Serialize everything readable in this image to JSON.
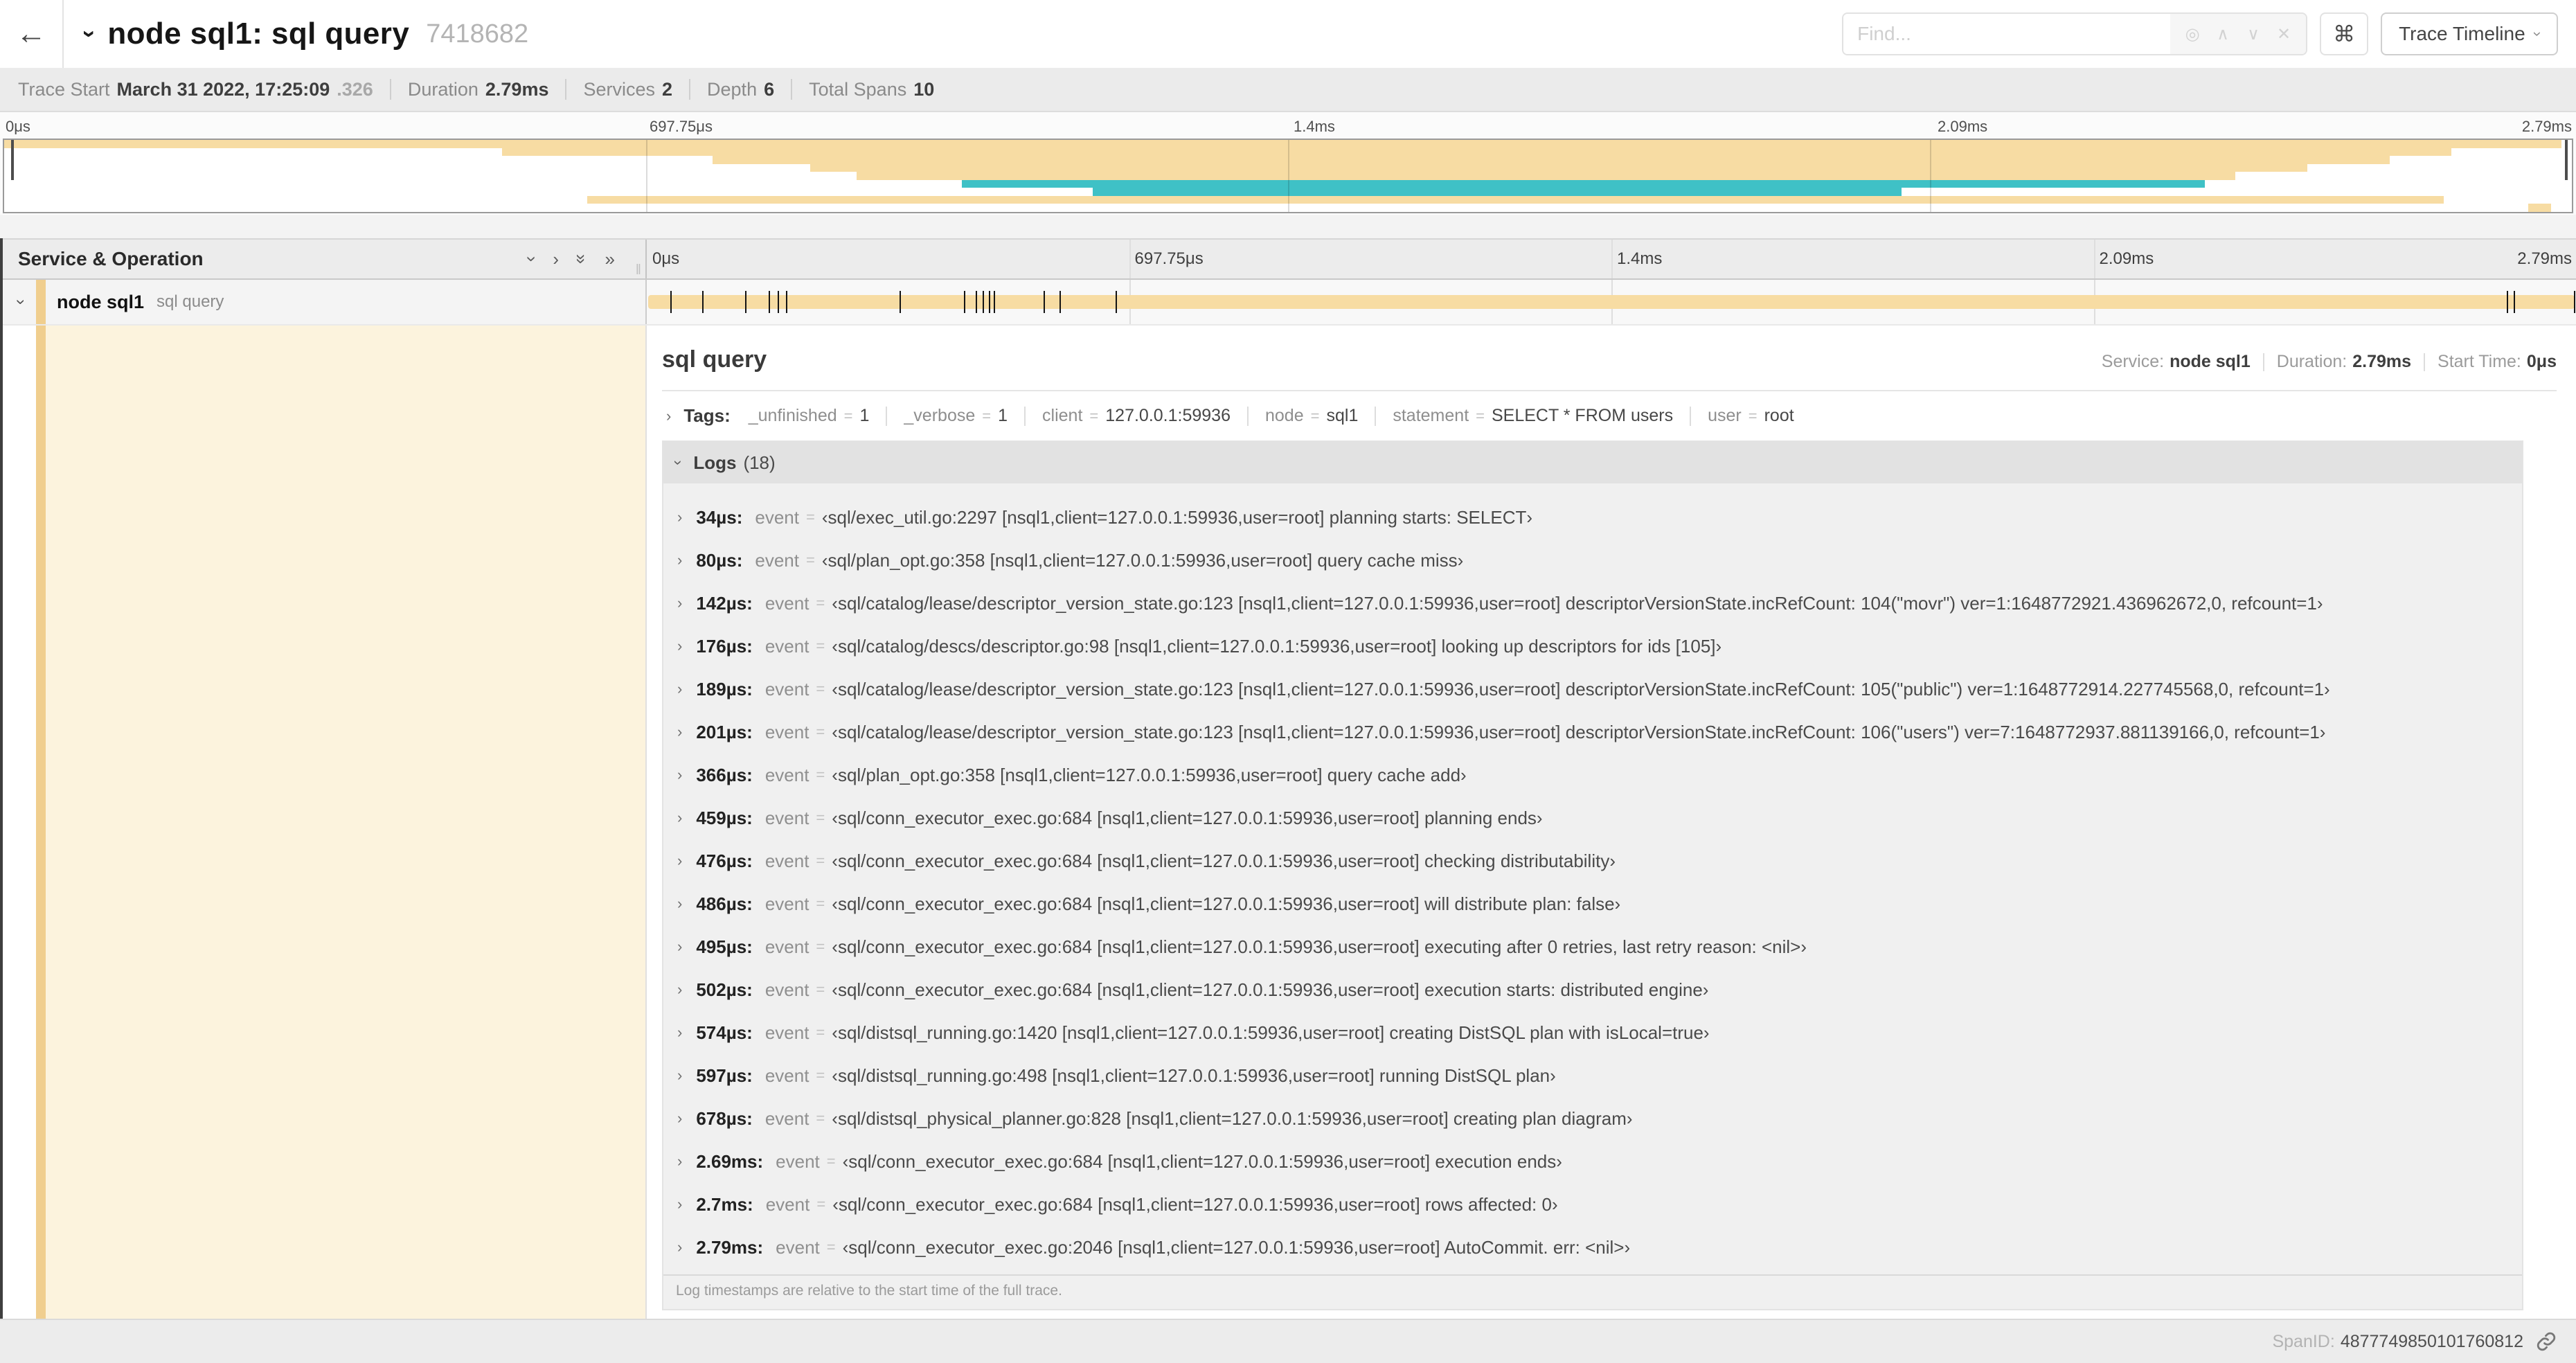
{
  "colors": {
    "tan": "#F7DCA3",
    "teal": "#3FC1C6",
    "stripe": "#F0CE8E"
  },
  "icons": {
    "back": "←",
    "chevron": "›",
    "double_chevron": "»",
    "command": "⌘",
    "locate": "◎",
    "up": "∧",
    "down": "∨",
    "clear": "✕",
    "grip": "‖"
  },
  "header": {
    "title": "node sql1: sql query",
    "trace_id": "7418682",
    "find_placeholder": "Find...",
    "view_select": "Trace Timeline"
  },
  "trace_meta": [
    {
      "label": "Trace Start",
      "value": "March 31 2022, 17:25:09",
      "suffix": ".326"
    },
    {
      "label": "Duration",
      "value": "2.79ms"
    },
    {
      "label": "Services",
      "value": "2"
    },
    {
      "label": "Depth",
      "value": "6"
    },
    {
      "label": "Total Spans",
      "value": "10"
    }
  ],
  "timeline": {
    "ticks": [
      {
        "label": "0μs",
        "pos": 0
      },
      {
        "label": "697.75μs",
        "pos": 25
      },
      {
        "label": "1.4ms",
        "pos": 50
      },
      {
        "label": "2.09ms",
        "pos": 75
      },
      {
        "label": "2.79ms",
        "pos": 100
      }
    ]
  },
  "minimap": {
    "rows": [
      {
        "start": 0,
        "end": 99.6,
        "color": "tan"
      },
      {
        "start": 19.4,
        "end": 95.3,
        "color": "tan"
      },
      {
        "start": 27.6,
        "end": 92.9,
        "color": "tan"
      },
      {
        "start": 31.4,
        "end": 89.7,
        "color": "tan"
      },
      {
        "start": 33.2,
        "end": 86.9,
        "color": "tan"
      },
      {
        "start": 37.3,
        "end": 85.7,
        "color": "teal"
      },
      {
        "start": 42.4,
        "end": 73.9,
        "color": "teal"
      },
      {
        "start": 22.7,
        "end": 95.0,
        "color": "tan"
      },
      {
        "start": 98.3,
        "end": 99.2,
        "color": "tan"
      }
    ]
  },
  "columns": {
    "left_title": "Service & Operation"
  },
  "span_row": {
    "service": "node sql1",
    "operation": "sql query",
    "duration_us": 2790,
    "log_marker_times_us": [
      34,
      80,
      142,
      176,
      189,
      201,
      366,
      459,
      476,
      486,
      495,
      502,
      574,
      597,
      678,
      2690,
      2700,
      2790
    ]
  },
  "detail": {
    "title": "sql query",
    "meta": [
      {
        "label": "Service:",
        "value": "node sql1"
      },
      {
        "label": "Duration:",
        "value": "2.79ms"
      },
      {
        "label": "Start Time:",
        "value": "0μs"
      }
    ],
    "tags_label": "Tags:",
    "tags": [
      {
        "key": "_unfinished",
        "value": "1"
      },
      {
        "key": "_verbose",
        "value": "1"
      },
      {
        "key": "client",
        "value": "127.0.0.1:59936"
      },
      {
        "key": "node",
        "value": "sql1"
      },
      {
        "key": "statement",
        "value": "SELECT * FROM users"
      },
      {
        "key": "user",
        "value": "root"
      }
    ],
    "logs_label": "Logs",
    "logs_count": "(18)",
    "logs": [
      {
        "time": "34µs:",
        "key": "event",
        "value": "‹sql/exec_util.go:2297 [nsql1,client=127.0.0.1:59936,user=root] planning starts: SELECT›"
      },
      {
        "time": "80µs:",
        "key": "event",
        "value": "‹sql/plan_opt.go:358 [nsql1,client=127.0.0.1:59936,user=root] query cache miss›"
      },
      {
        "time": "142µs:",
        "key": "event",
        "value": "‹sql/catalog/lease/descriptor_version_state.go:123 [nsql1,client=127.0.0.1:59936,user=root] descriptorVersionState.incRefCount: 104(\"movr\") ver=1:1648772921.436962672,0, refcount=1›"
      },
      {
        "time": "176µs:",
        "key": "event",
        "value": "‹sql/catalog/descs/descriptor.go:98 [nsql1,client=127.0.0.1:59936,user=root] looking up descriptors for ids [105]›"
      },
      {
        "time": "189µs:",
        "key": "event",
        "value": "‹sql/catalog/lease/descriptor_version_state.go:123 [nsql1,client=127.0.0.1:59936,user=root] descriptorVersionState.incRefCount: 105(\"public\") ver=1:1648772914.227745568,0, refcount=1›"
      },
      {
        "time": "201µs:",
        "key": "event",
        "value": "‹sql/catalog/lease/descriptor_version_state.go:123 [nsql1,client=127.0.0.1:59936,user=root] descriptorVersionState.incRefCount: 106(\"users\") ver=7:1648772937.881139166,0, refcount=1›"
      },
      {
        "time": "366µs:",
        "key": "event",
        "value": "‹sql/plan_opt.go:358 [nsql1,client=127.0.0.1:59936,user=root] query cache add›"
      },
      {
        "time": "459µs:",
        "key": "event",
        "value": "‹sql/conn_executor_exec.go:684 [nsql1,client=127.0.0.1:59936,user=root] planning ends›"
      },
      {
        "time": "476µs:",
        "key": "event",
        "value": "‹sql/conn_executor_exec.go:684 [nsql1,client=127.0.0.1:59936,user=root] checking distributability›"
      },
      {
        "time": "486µs:",
        "key": "event",
        "value": "‹sql/conn_executor_exec.go:684 [nsql1,client=127.0.0.1:59936,user=root] will distribute plan: false›"
      },
      {
        "time": "495µs:",
        "key": "event",
        "value": "‹sql/conn_executor_exec.go:684 [nsql1,client=127.0.0.1:59936,user=root] executing after 0 retries, last retry reason: <nil>›"
      },
      {
        "time": "502µs:",
        "key": "event",
        "value": "‹sql/conn_executor_exec.go:684 [nsql1,client=127.0.0.1:59936,user=root] execution starts: distributed engine›"
      },
      {
        "time": "574µs:",
        "key": "event",
        "value": "‹sql/distsql_running.go:1420 [nsql1,client=127.0.0.1:59936,user=root] creating DistSQL plan with isLocal=true›"
      },
      {
        "time": "597µs:",
        "key": "event",
        "value": "‹sql/distsql_running.go:498 [nsql1,client=127.0.0.1:59936,user=root] running DistSQL plan›"
      },
      {
        "time": "678µs:",
        "key": "event",
        "value": "‹sql/distsql_physical_planner.go:828 [nsql1,client=127.0.0.1:59936,user=root] creating plan diagram›"
      },
      {
        "time": "2.69ms:",
        "key": "event",
        "value": "‹sql/conn_executor_exec.go:684 [nsql1,client=127.0.0.1:59936,user=root] execution ends›"
      },
      {
        "time": "2.7ms:",
        "key": "event",
        "value": "‹sql/conn_executor_exec.go:684 [nsql1,client=127.0.0.1:59936,user=root] rows affected: 0›"
      },
      {
        "time": "2.79ms:",
        "key": "event",
        "value": "‹sql/conn_executor_exec.go:2046 [nsql1,client=127.0.0.1:59936,user=root] AutoCommit. err: <nil>›"
      }
    ],
    "footnote": "Log timestamps are relative to the start time of the full trace.",
    "span_id_label": "SpanID:",
    "span_id": "4877749850101760812"
  }
}
